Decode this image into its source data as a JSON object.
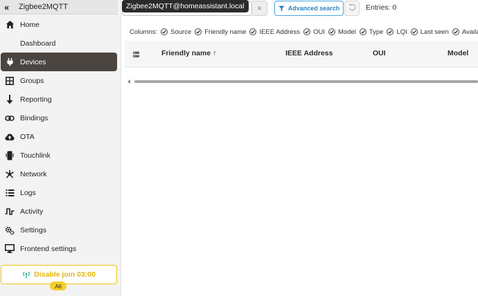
{
  "app": {
    "title": "Zigbee2MQTT"
  },
  "sidebar": {
    "items": [
      {
        "label": "Home",
        "icon": "home-icon"
      },
      {
        "label": "Dashboard",
        "icon": "dashboard-icon"
      },
      {
        "label": "Devices",
        "icon": "plug-icon",
        "active": true
      },
      {
        "label": "Groups",
        "icon": "grid-icon"
      },
      {
        "label": "Reporting",
        "icon": "arrow-down-icon"
      },
      {
        "label": "Bindings",
        "icon": "link-icon"
      },
      {
        "label": "OTA",
        "icon": "cloud-upload-icon"
      },
      {
        "label": "Touchlink",
        "icon": "mobile-icon"
      },
      {
        "label": "Network",
        "icon": "network-icon"
      },
      {
        "label": "Logs",
        "icon": "list-icon"
      },
      {
        "label": "Activity",
        "icon": "pulse-icon"
      },
      {
        "label": "Settings",
        "icon": "gears-icon"
      },
      {
        "label": "Frontend settings",
        "icon": "monitor-icon"
      }
    ],
    "join_button": {
      "label": "Disable join  03:00",
      "badge": "All"
    }
  },
  "toolbar": {
    "search_tooltip": "Zigbee2MQTT@homeassistant.local",
    "clear_label": "×",
    "advanced_search_label": "Advanced search",
    "entries_label": "Entries: 0"
  },
  "columns": {
    "label": "Columns:",
    "toggles": [
      "Source",
      "Friendly name",
      "IEEE Address",
      "OUI",
      "Model",
      "Type",
      "LQI",
      "Last seen",
      "Availability"
    ]
  },
  "table": {
    "headers": [
      "Friendly name ↑",
      "IEEE Address",
      "OUI",
      "Model"
    ]
  },
  "colors": {
    "active_nav_bg": "#4a4540",
    "join_accent": "#f0c419",
    "advanced_accent": "#2a84c8"
  }
}
